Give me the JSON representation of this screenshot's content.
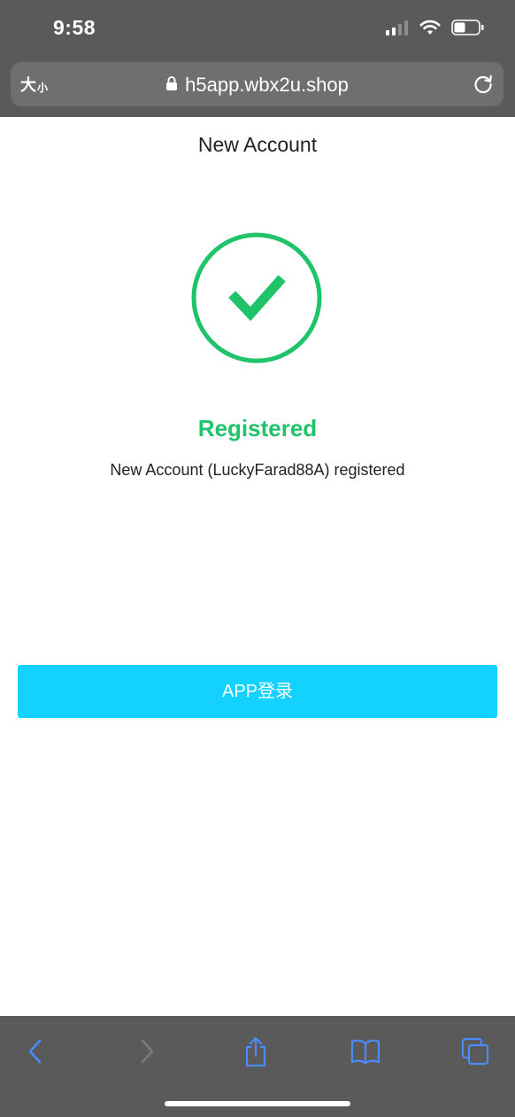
{
  "status_bar": {
    "time": "9:58"
  },
  "browser": {
    "text_size_label": "大",
    "text_size_small_label": "小",
    "url": "h5app.wbx2u.shop"
  },
  "page": {
    "title": "New Account",
    "result_title": "Registered",
    "result_description": "New Account (LuckyFarad88A) registered",
    "app_login_label": "APP登录"
  },
  "colors": {
    "success_green": "#1fc36a",
    "button_blue": "#14d2ff",
    "browser_chrome": "#5a5a5a",
    "toolbar_icon_blue": "#4a8cff"
  },
  "toolbar": {
    "icons": [
      "back-icon",
      "forward-icon",
      "share-icon",
      "bookmarks-icon",
      "tabs-icon"
    ]
  }
}
